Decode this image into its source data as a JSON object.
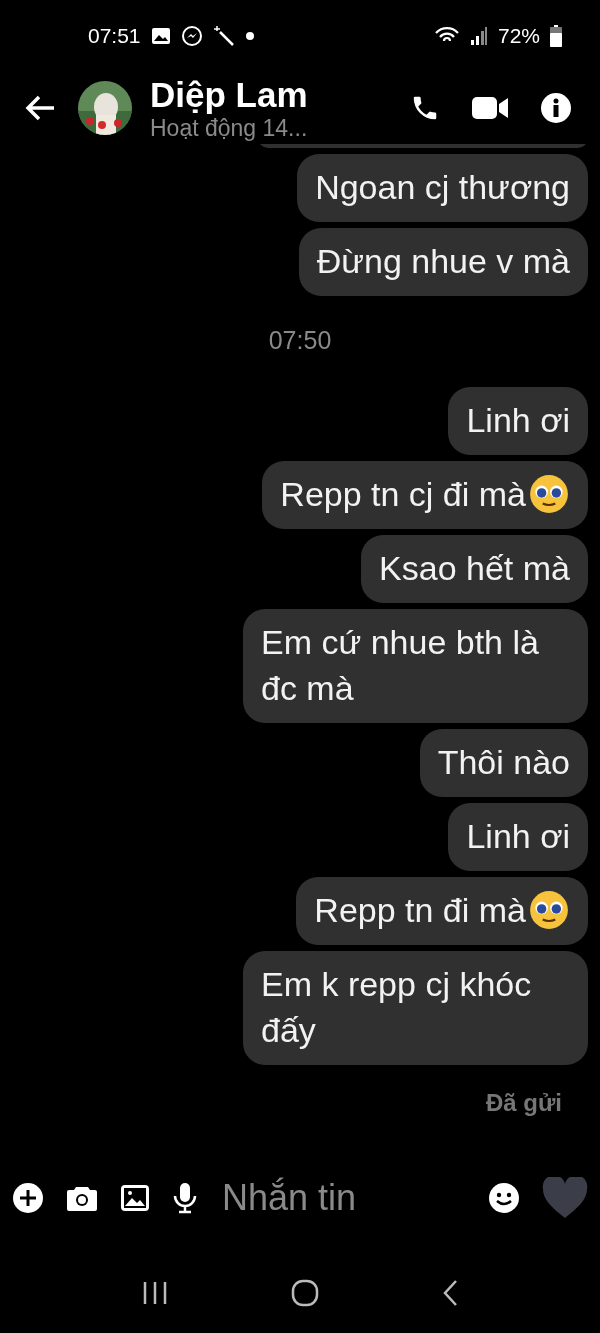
{
  "status_bar": {
    "time": "07:51",
    "battery": "72%"
  },
  "header": {
    "name": "Diệp Lam",
    "subtitle": "Hoạt động 14..."
  },
  "messages": [
    {
      "kind": "message",
      "text": "Ngoan cj thương",
      "pleading_emoji": false
    },
    {
      "kind": "message",
      "text": "Đừng nhue v mà",
      "pleading_emoji": false
    },
    {
      "kind": "time",
      "text": "07:50"
    },
    {
      "kind": "message",
      "text": "Linh ơi",
      "pleading_emoji": false
    },
    {
      "kind": "message",
      "text": "Repp tn cj đi mà",
      "pleading_emoji": true
    },
    {
      "kind": "message",
      "text": "Ksao hết mà",
      "pleading_emoji": false
    },
    {
      "kind": "message",
      "text": "Em cứ nhue bth là đc mà",
      "pleading_emoji": false
    },
    {
      "kind": "message",
      "text": "Thôi nào",
      "pleading_emoji": false
    },
    {
      "kind": "message",
      "text": "Linh ơi",
      "pleading_emoji": false
    },
    {
      "kind": "message",
      "text": "Repp tn đi mà",
      "pleading_emoji": true
    },
    {
      "kind": "message",
      "text": "Em k repp cj khóc đấy",
      "pleading_emoji": false
    }
  ],
  "delivery_status": "Đã gửi",
  "composer": {
    "placeholder": "Nhắn tin"
  }
}
